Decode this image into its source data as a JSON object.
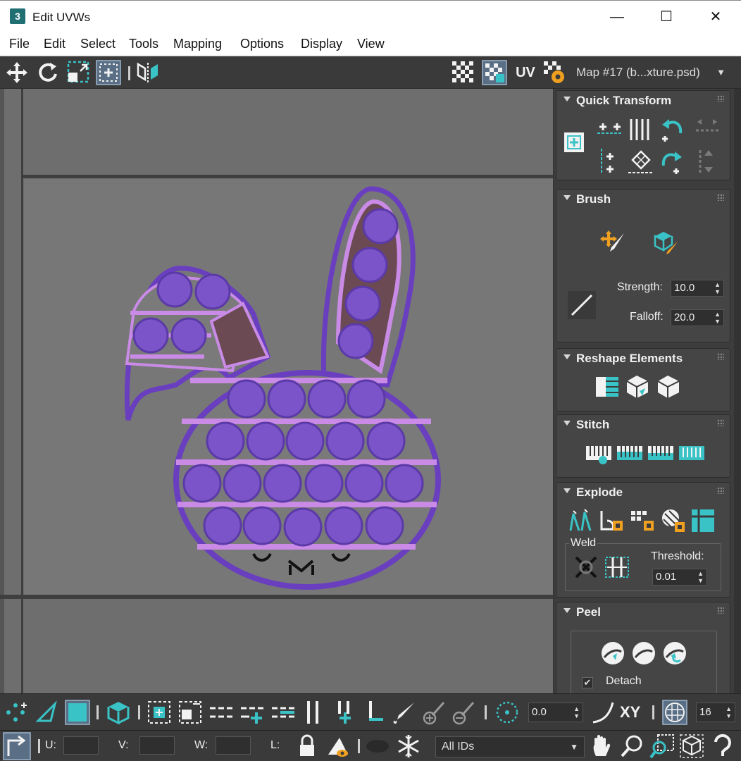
{
  "window": {
    "title": "Edit UVWs",
    "app_icon_label": "3",
    "minimize_glyph": "—",
    "maximize_glyph": "☐",
    "close_glyph": "✕"
  },
  "menu": {
    "items": [
      "File",
      "Edit",
      "Select",
      "Tools",
      "Mapping",
      "Options",
      "Display",
      "View"
    ]
  },
  "top_toolbar": {
    "uv_label": "UV",
    "map_dropdown": "Map #17 (b...xture.psd)"
  },
  "panel": {
    "quick_transform": {
      "title": "Quick Transform"
    },
    "brush": {
      "title": "Brush",
      "strength_label": "Strength:",
      "strength_value": "10.0",
      "falloff_label": "Falloff:",
      "falloff_value": "20.0"
    },
    "reshape": {
      "title": "Reshape Elements"
    },
    "stitch": {
      "title": "Stitch"
    },
    "explode": {
      "title": "Explode",
      "weld_label": "Weld",
      "threshold_label": "Threshold:",
      "threshold_value": "0.01"
    },
    "peel": {
      "title": "Peel",
      "detach_label": "Detach",
      "detach_checked": true
    }
  },
  "bottom_toolbar": {
    "rotate_value": "0.0",
    "xy_label": "XY",
    "grid_value": "16",
    "u_label": "U:",
    "v_label": "V:",
    "w_label": "W:",
    "l_label": "L:",
    "ids_dropdown": "All IDs"
  },
  "colors": {
    "accent_cyan": "#3ac3c6",
    "uv_purple": "#6a3fbf",
    "uv_light_purple": "#c98be6",
    "uv_fill_brown": "#6b4a54",
    "warning_orange": "#f0a020"
  }
}
